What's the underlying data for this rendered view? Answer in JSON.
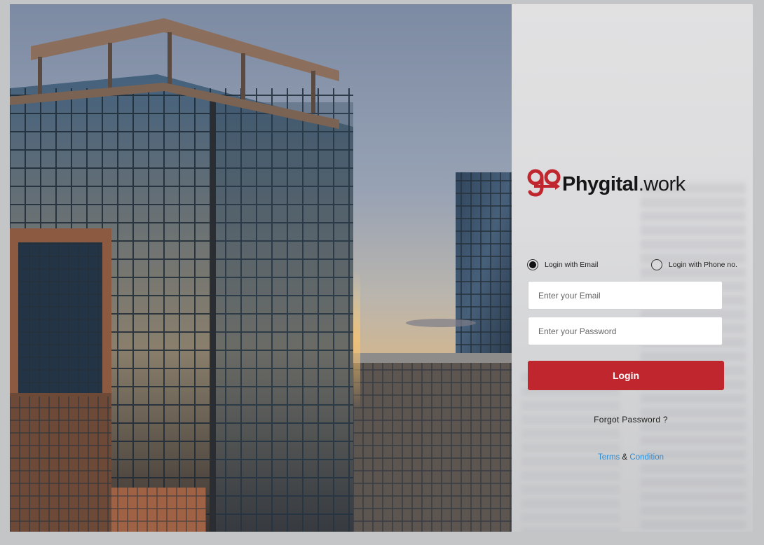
{
  "brand": {
    "logo_mark": "go",
    "name_bold": "Phygital",
    "name_suffix": ".work",
    "accent_color": "#c0262e"
  },
  "login_form": {
    "mode_options": [
      {
        "label": "Login with Email",
        "selected": true
      },
      {
        "label": "Login with Phone no.",
        "selected": false
      }
    ],
    "email_placeholder": "Enter your Email",
    "password_placeholder": "Enter your Password",
    "submit_label": "Login",
    "forgot_password": "Forgot Password ?",
    "terms_word": "Terms",
    "terms_ampersand": "&",
    "condition_word": "Condition",
    "link_color": "#2e8fd6"
  }
}
